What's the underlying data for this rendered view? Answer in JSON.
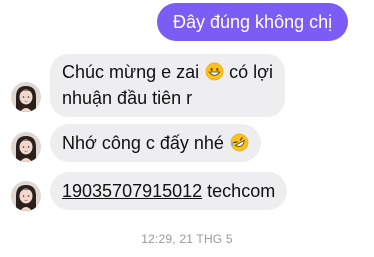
{
  "conversation": {
    "sent_message": {
      "text": "Đây đúng không chị"
    },
    "received_messages": [
      {
        "line1": "Chúc mừng e zai",
        "line1_suffix": "có lợi",
        "line2": "nhuận đầu tiên r",
        "emoji": "grinning-face-emoji"
      },
      {
        "text": "Nhớ công c đấy nhé",
        "emoji": "rolling-on-floor-laughing-emoji"
      },
      {
        "link_text": "19035707915012",
        "text_after": "techcom"
      }
    ],
    "timestamp": "12:29, 21 THG 5"
  },
  "colors": {
    "sent_bubble": "#7b5cf5",
    "received_bubble": "#eeedf0",
    "timestamp": "#9a99a0"
  }
}
